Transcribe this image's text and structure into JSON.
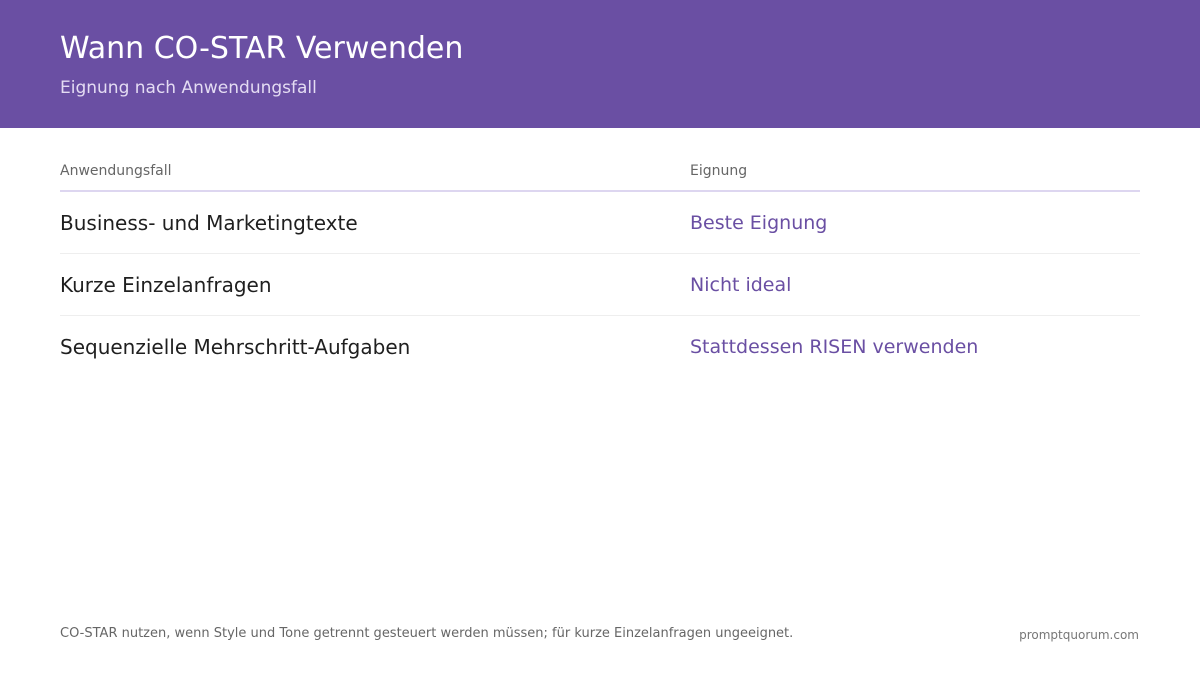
{
  "header": {
    "title": "Wann CO-STAR Verwenden",
    "subtitle": "Eignung nach Anwendungsfall",
    "background_color": "#6a4fa3"
  },
  "table": {
    "columns": [
      "Anwendungsfall",
      "Eignung"
    ],
    "rows": [
      {
        "use_case": "Business- und Marketingtexte",
        "suitability": "Beste Eignung"
      },
      {
        "use_case": "Kurze Einzelanfragen",
        "suitability": "Nicht ideal"
      },
      {
        "use_case": "Sequenzielle Mehrschritt-Aufgaben",
        "suitability": "Stattdessen RISEN verwenden"
      }
    ],
    "accent_color": "#6a4fa3"
  },
  "footer": {
    "note": "CO-STAR nutzen, wenn Style und Tone getrennt gesteuert werden müssen; für kurze Einzelanfragen ungeeignet.",
    "site": "promptquorum.com"
  }
}
